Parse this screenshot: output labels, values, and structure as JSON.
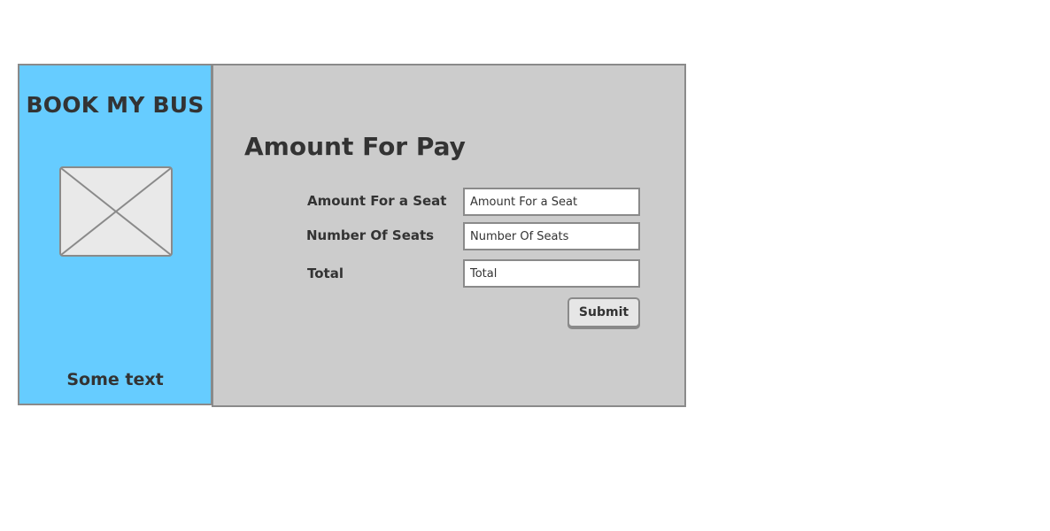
{
  "sidebar": {
    "brand": "BOOK MY BUS",
    "image_icon": "image-placeholder-icon",
    "footer_text": "Some text",
    "background_color": "#66ccff"
  },
  "main": {
    "title": "Amount For Pay",
    "background_color": "#cccccc",
    "fields": [
      {
        "label": "Amount For a Seat",
        "placeholder": "Amount For a Seat"
      },
      {
        "label": "Number Of Seats",
        "placeholder": "Number Of Seats"
      },
      {
        "label": "Total",
        "placeholder": "Total"
      }
    ],
    "submit_label": "Submit"
  }
}
